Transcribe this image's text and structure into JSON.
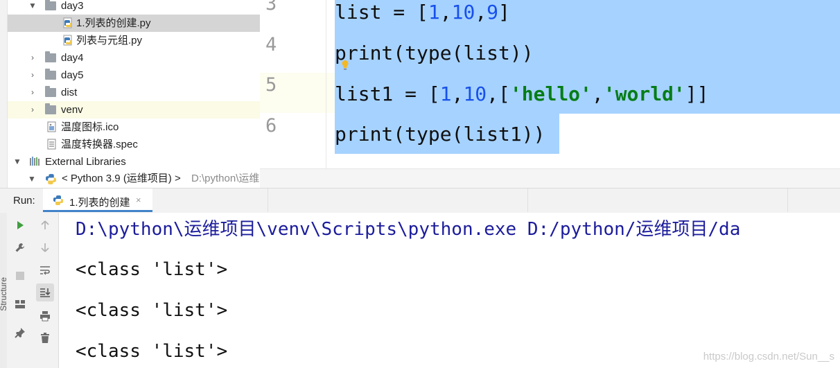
{
  "project_tree": {
    "items": [
      {
        "label": "day3",
        "type": "folder",
        "expanded": true
      },
      {
        "label": "1.列表的创建.py",
        "type": "python-file",
        "selected": true
      },
      {
        "label": "列表与元组.py",
        "type": "python-file"
      },
      {
        "label": "day4",
        "type": "folder",
        "expanded": false
      },
      {
        "label": "day5",
        "type": "folder",
        "expanded": false
      },
      {
        "label": "dist",
        "type": "folder",
        "expanded": false
      },
      {
        "label": "venv",
        "type": "folder",
        "expanded": false
      },
      {
        "label": "温度图标.ico",
        "type": "file"
      },
      {
        "label": "温度转换器.spec",
        "type": "file"
      },
      {
        "label": "External Libraries",
        "type": "libraries",
        "expanded": true
      }
    ],
    "python_sdk": {
      "label": "< Python 3.9 (运维项目) >",
      "path": "D:\\python\\运维"
    }
  },
  "editor": {
    "lines": [
      {
        "number": "3"
      },
      {
        "number": "4"
      },
      {
        "number": "5"
      },
      {
        "number": "6"
      }
    ],
    "tokens": {
      "line3": [
        "list",
        " = ",
        "[",
        "1",
        ",",
        "10",
        ",",
        "9",
        "]"
      ],
      "line4": [
        "print",
        "(",
        "type",
        "(",
        "list",
        "))"
      ],
      "line5": [
        "list1",
        " = ",
        "[",
        "1",
        ",",
        "10",
        ",",
        "[",
        "'hello'",
        ",",
        "'world'",
        "]]"
      ],
      "line6": [
        "print",
        "(",
        "type",
        "(",
        "list1",
        "))"
      ]
    }
  },
  "run_panel": {
    "label": "Run:",
    "tab_label": "1.列表的创建",
    "tab_close": "×",
    "console_lines": [
      "D:\\python\\运维项目\\venv\\Scripts\\python.exe D:/python/运维项目/da",
      "<class 'list'>",
      "<class 'list'>",
      "<class 'list'>"
    ]
  },
  "side_label": "Structure",
  "watermark": "https://blog.csdn.net/Sun__s",
  "colors": {
    "selection": "#a6d2ff",
    "keyword_number": "#1750eb",
    "string": "#067d17",
    "console_command": "#1c1c9c",
    "tab_underline": "#4083c9",
    "run_green": "#3f9e3f"
  },
  "icons": {
    "run": "play-icon",
    "rerun": "wrench-icon",
    "stop": "stop-icon",
    "layout": "layout-icon",
    "pin": "pin-icon",
    "up": "arrow-up-icon",
    "down": "arrow-down-icon",
    "soft_wrap": "soft-wrap-icon",
    "scroll_end": "scroll-to-end-icon",
    "print": "print-icon",
    "trash": "trash-icon"
  }
}
